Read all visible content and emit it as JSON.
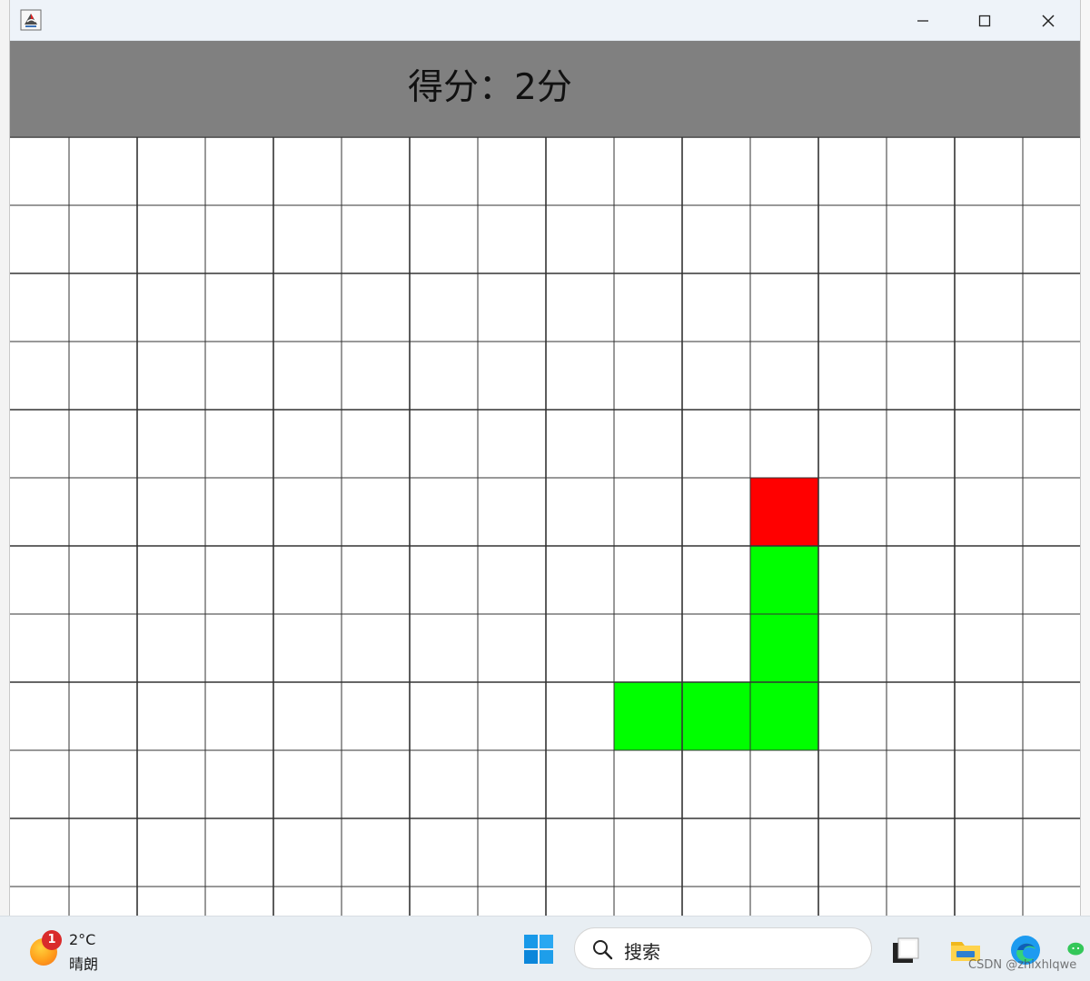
{
  "window": {
    "title_icon": "java-icon",
    "controls": {
      "minimize": "minimize-icon",
      "maximize": "maximize-icon",
      "close": "close-icon"
    }
  },
  "game": {
    "score_text": "得分：2分",
    "score_value": 2,
    "grid": {
      "columns": 16,
      "rows": 12
    },
    "food": {
      "column": 11,
      "row": 5,
      "color": "#ff0000"
    },
    "snake": {
      "color": "#00ff00",
      "segments": [
        {
          "column": 11,
          "row": 6
        },
        {
          "column": 11,
          "row": 7
        },
        {
          "column": 11,
          "row": 8
        },
        {
          "column": 10,
          "row": 8
        },
        {
          "column": 9,
          "row": 8
        }
      ]
    }
  },
  "taskbar": {
    "weather": {
      "badge": "1",
      "temp": "2°C",
      "desc": "晴朗"
    },
    "search": {
      "label": "搜索"
    },
    "icons": [
      "windows-start-icon",
      "task-view-icon",
      "file-explorer-icon",
      "edge-browser-icon",
      "wechat-icon"
    ],
    "watermark": "CSDN @zhixhlqwe"
  }
}
